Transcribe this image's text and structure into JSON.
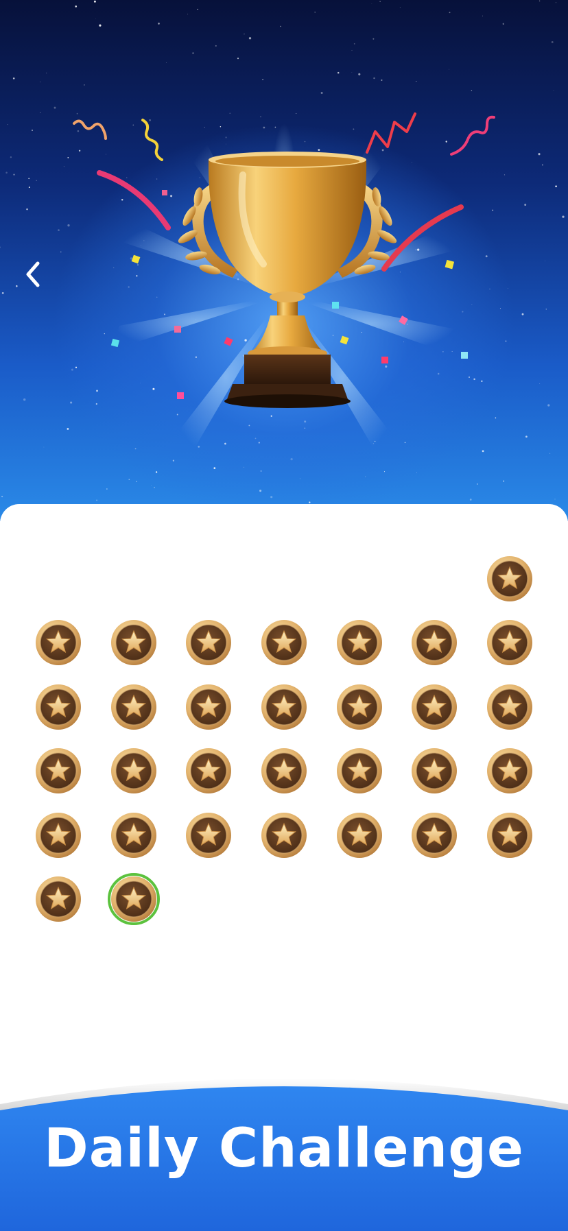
{
  "hero": {
    "back_icon": "chevron-left-icon",
    "trophy_icon": "gold-trophy-icon"
  },
  "calendar": {
    "medal_icon": "star-medal-icon",
    "leading_empty_slots": 6,
    "medal_count": 31,
    "columns": 7,
    "selected_index": 30,
    "selected_ring_color": "#5cc23e"
  },
  "banner": {
    "title": "Daily Challenge",
    "color": "#2a78ea"
  }
}
